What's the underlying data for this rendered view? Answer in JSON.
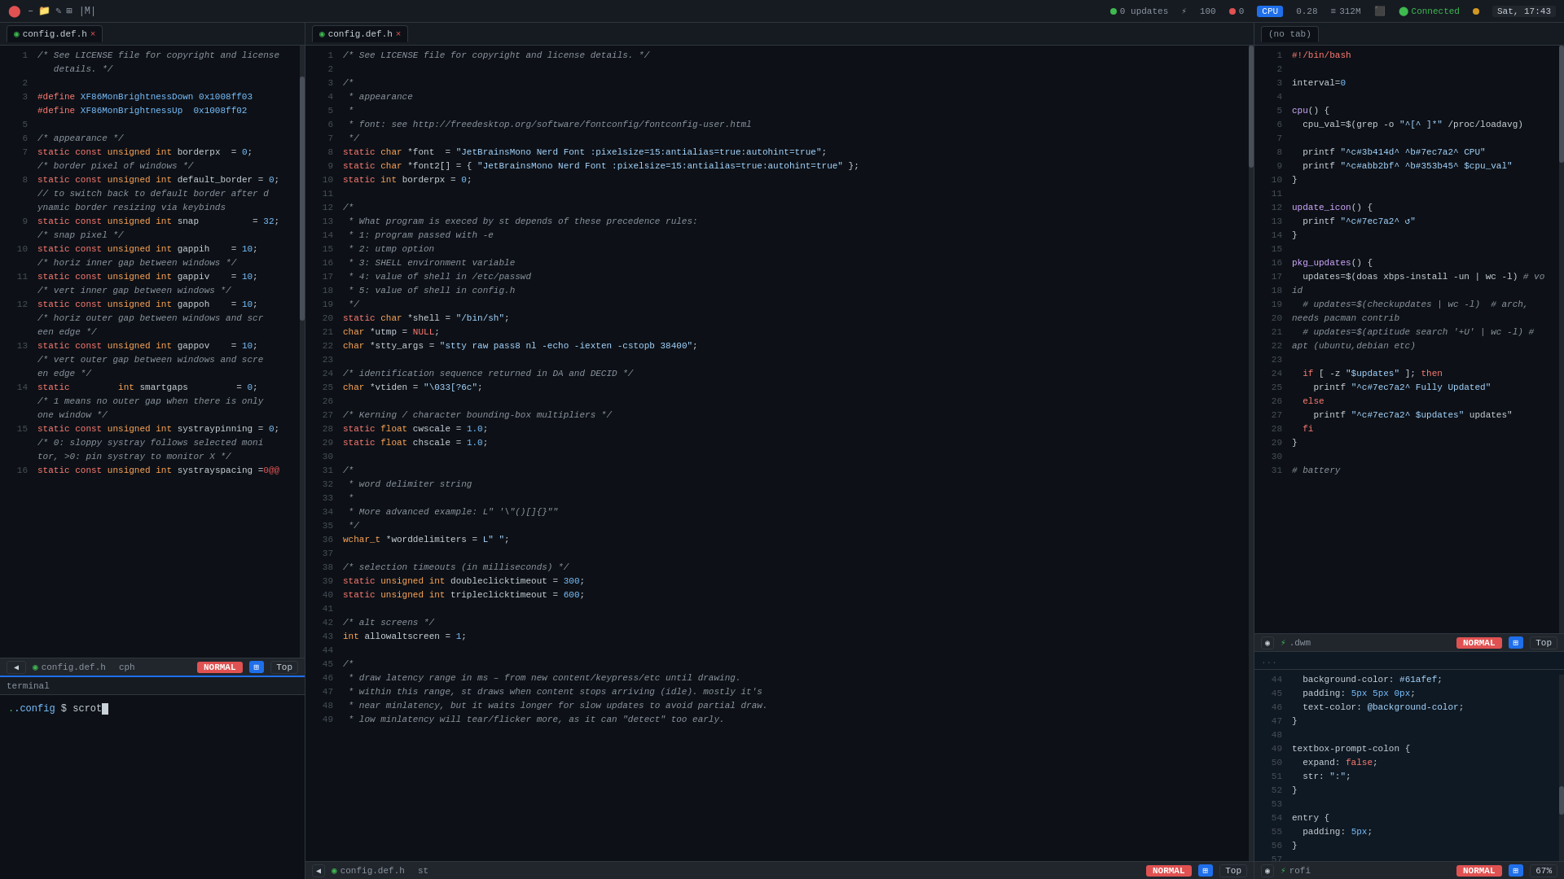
{
  "topbar": {
    "title": "|M|",
    "icons": [
      "–",
      "□",
      "×"
    ],
    "system": {
      "updates": "0 updates",
      "cpu_num": "100",
      "cpu_label": "CPU",
      "cpu_val": "0.28",
      "mem_label": "312M",
      "connected": "Connected",
      "time": "Sat, 17:43"
    }
  },
  "panels": {
    "left": {
      "tab": "config.def.h",
      "status_mode": "NORMAL",
      "status_pos": "Top",
      "status_file": "config.def.h",
      "status_branch": "cph",
      "lines": [
        {
          "num": "1",
          "content": "/* See LICENSE file for copyright and license",
          "type": "cmt"
        },
        {
          "num": "",
          "content": "   details. */",
          "type": "cmt"
        },
        {
          "num": "2",
          "content": "",
          "type": "normal"
        },
        {
          "num": "3",
          "content": "#define XF86MonBrightnessDown 0x1008ff03",
          "type": "def"
        },
        {
          "num": "",
          "content": "#define XF86MonBrightnessUp  0x1008ff02",
          "type": "def"
        },
        {
          "num": "5",
          "content": "",
          "type": "normal"
        },
        {
          "num": "6",
          "content": "/* appearance */",
          "type": "cmt"
        },
        {
          "num": "7",
          "content": "static const unsigned int borderpx  = 0;",
          "type": "code"
        },
        {
          "num": "",
          "content": "/* border pixel of windows */",
          "type": "cmt"
        },
        {
          "num": "8",
          "content": "static const unsigned int default_border = 0;",
          "type": "code"
        },
        {
          "num": "",
          "content": "// to switch back to default border after d",
          "type": "cmt"
        },
        {
          "num": "",
          "content": "ynamic border resizing via keybinds",
          "type": "cmt"
        },
        {
          "num": "9",
          "content": "static const unsigned int snap          = 32;",
          "type": "code"
        },
        {
          "num": "",
          "content": "/* snap pixel */",
          "type": "cmt"
        },
        {
          "num": "10",
          "content": "static const unsigned int gappih    = 10;",
          "type": "code"
        },
        {
          "num": "",
          "content": "/* horiz inner gap between windows */",
          "type": "cmt"
        },
        {
          "num": "11",
          "content": "static const unsigned int gappiv    = 10;",
          "type": "code"
        },
        {
          "num": "",
          "content": "/* vert inner gap between windows */",
          "type": "cmt"
        },
        {
          "num": "12",
          "content": "static const unsigned int gappoh    = 10;",
          "type": "code"
        },
        {
          "num": "",
          "content": "/* horiz outer gap between windows and scr",
          "type": "cmt"
        },
        {
          "num": "",
          "content": "een edge */",
          "type": "cmt"
        },
        {
          "num": "13",
          "content": "static const unsigned int gappov    = 10;",
          "type": "code"
        },
        {
          "num": "",
          "content": "/* vert outer gap between windows and scre",
          "type": "cmt"
        },
        {
          "num": "",
          "content": "en edge */",
          "type": "cmt"
        },
        {
          "num": "14",
          "content": "static         int smartgaps         = 0;",
          "type": "code"
        },
        {
          "num": "",
          "content": "/* 1 means no outer gap when there is only",
          "type": "cmt"
        },
        {
          "num": "",
          "content": "one window */",
          "type": "cmt"
        },
        {
          "num": "15",
          "content": "static const unsigned int systraypinning = 0;",
          "type": "code"
        },
        {
          "num": "",
          "content": "/* 0: sloppy systray follows selected moni",
          "type": "cmt"
        },
        {
          "num": "",
          "content": "tor, >0: pin systray to monitor X */",
          "type": "cmt"
        },
        {
          "num": "16",
          "content": "static const unsigned int systrayspacing =0@@",
          "type": "code"
        }
      ]
    },
    "mid": {
      "tab": "config.def.h",
      "status_mode": "NORMAL",
      "status_pos": "Top",
      "status_file": "config.def.h",
      "status_branch": "st",
      "lines": [
        {
          "num": "1",
          "content": "/* See LICENSE file for copyright and license details. */"
        },
        {
          "num": "2",
          "content": ""
        },
        {
          "num": "3",
          "content": "/*"
        },
        {
          "num": "4",
          "content": " * appearance"
        },
        {
          "num": "5",
          "content": " *"
        },
        {
          "num": "6",
          "content": " * font: see http://freedesktop.org/software/fontconfig/fontconfig-user.html"
        },
        {
          "num": "7",
          "content": " */"
        },
        {
          "num": "8",
          "content": "static char *font  = \"JetBrainsMono Nerd Font :pixelsize=15:antialias=true:autohint=true\";"
        },
        {
          "num": "9",
          "content": "static char *font2[] = { \"JetBrainsMono Nerd Font :pixelsize=15:antialias=true:autohint=true\" };"
        },
        {
          "num": "10",
          "content": "static int borderpx = 0;"
        },
        {
          "num": "11",
          "content": ""
        },
        {
          "num": "12",
          "content": "/*"
        },
        {
          "num": "13",
          "content": " * What program is execed by st depends of these precedence rules:"
        },
        {
          "num": "14",
          "content": " * 1: program passed with -e"
        },
        {
          "num": "15",
          "content": " * 2: utmp option"
        },
        {
          "num": "16",
          "content": " * 3: SHELL environment variable"
        },
        {
          "num": "17",
          "content": " * 4: value of shell in /etc/passwd"
        },
        {
          "num": "18",
          "content": " * 5: value of shell in config.h"
        },
        {
          "num": "19",
          "content": " */"
        },
        {
          "num": "20",
          "content": "static char *shell = \"/bin/sh\";"
        },
        {
          "num": "21",
          "content": "char *utmp = NULL;"
        },
        {
          "num": "22",
          "content": "char *stty_args = \"stty raw pass8 nl -echo -iexten -cstopb 38400\";"
        },
        {
          "num": "23",
          "content": ""
        },
        {
          "num": "24",
          "content": "/* identification sequence returned in DA and DECID */"
        },
        {
          "num": "25",
          "content": "char *vtiden = \"\\033[?6c\";"
        },
        {
          "num": "26",
          "content": ""
        },
        {
          "num": "27",
          "content": "/* Kerning / character bounding-box multipliers */"
        },
        {
          "num": "28",
          "content": "static float cwscale = 1.0;"
        },
        {
          "num": "29",
          "content": "static float chscale = 1.0;"
        },
        {
          "num": "30",
          "content": ""
        },
        {
          "num": "31",
          "content": "/*"
        },
        {
          "num": "32",
          "content": " * word delimiter string"
        },
        {
          "num": "33",
          "content": " *"
        },
        {
          "num": "34",
          "content": " * More advanced example: L\" '\\\"()[]{}\""
        },
        {
          "num": "35",
          "content": " */"
        },
        {
          "num": "36",
          "content": "wchar_t *worddelimiters = L\" \";"
        },
        {
          "num": "37",
          "content": ""
        },
        {
          "num": "38",
          "content": "/* selection timeouts (in milliseconds) */"
        },
        {
          "num": "39",
          "content": "static unsigned int doubleclicktimeout = 300;"
        },
        {
          "num": "40",
          "content": "static unsigned int tripleclicktimeout = 600;"
        },
        {
          "num": "41",
          "content": ""
        },
        {
          "num": "42",
          "content": "/* alt screens */"
        },
        {
          "num": "43",
          "content": "int allowaltscreen = 1;"
        },
        {
          "num": "44",
          "content": ""
        },
        {
          "num": "45",
          "content": "/*"
        },
        {
          "num": "46",
          "content": " * draw latency range in ms – from new content/keypress/etc until drawing."
        },
        {
          "num": "47",
          "content": " * within this range, st draws when content stops arriving (idle). mostly it's"
        },
        {
          "num": "48",
          "content": " * near minlatency, but it waits longer for slow updates to avoid partial draw."
        },
        {
          "num": "49",
          "content": " * low minlatency will tear/flicker more, as it can \"detect\" too early."
        }
      ]
    },
    "right_top": {
      "tab": "",
      "status_mode": "NORMAL",
      "status_pos": "Top",
      "status_file": ".dwm",
      "lines": [
        {
          "num": "1",
          "content": "#!/bin/bash"
        },
        {
          "num": "2",
          "content": ""
        },
        {
          "num": "3",
          "content": "interval=0"
        },
        {
          "num": "4",
          "content": ""
        },
        {
          "num": "5",
          "content": "cpu() {"
        },
        {
          "num": "6",
          "content": "  cpu_val=$(grep -o \"^[^ ]*\" /proc/loadavg)"
        },
        {
          "num": "7",
          "content": ""
        },
        {
          "num": "8",
          "content": "  printf \"^c#3b414d^ ^b#7ec7a2^ CPU\""
        },
        {
          "num": "9",
          "content": "  printf \"^c#abb2bf^ ^b#353b45^ $cpu_val\""
        },
        {
          "num": "10",
          "content": "}"
        },
        {
          "num": "11",
          "content": ""
        },
        {
          "num": "12",
          "content": "update_icon() {"
        },
        {
          "num": "13",
          "content": "  printf \"^c#7ec7a2^ ↺\""
        },
        {
          "num": "14",
          "content": "}"
        },
        {
          "num": "15",
          "content": ""
        },
        {
          "num": "16",
          "content": "pkg_updates() {"
        },
        {
          "num": "17",
          "content": "  updates=$(doas xbps-install -un | wc -l) # vo"
        },
        {
          "num": "18",
          "content": "id"
        },
        {
          "num": "19",
          "content": "  # updates=$(checkupdates | wc -l)  # arch,"
        },
        {
          "num": "20",
          "content": "needs pacman contrib"
        },
        {
          "num": "21",
          "content": "  # updates=$(aptitude search '+U' | wc -l) #"
        },
        {
          "num": "22",
          "content": "apt (ubuntu,debian etc)"
        },
        {
          "num": "23",
          "content": ""
        },
        {
          "num": "24",
          "content": "  if [ -z \"$updates\" ]; then"
        },
        {
          "num": "25",
          "content": "    printf \"^c#7ec7a2^ Fully Updated\""
        },
        {
          "num": "26",
          "content": "  else"
        },
        {
          "num": "27",
          "content": "    printf \"^c#7ec7a2^ $updates\" updates\""
        },
        {
          "num": "28",
          "content": "  fi"
        },
        {
          "num": "29",
          "content": "}"
        },
        {
          "num": "30",
          "content": ""
        },
        {
          "num": "31",
          "content": "# battery"
        }
      ]
    },
    "right_bottom": {
      "status_mode": "NORMAL",
      "status_pos": "67%",
      "status_file": "rofi",
      "lines": [
        {
          "num": "44",
          "content": "  background-color: #61afef;"
        },
        {
          "num": "45",
          "content": "  padding: 5px 5px 0px;"
        },
        {
          "num": "46",
          "content": "  text-color: @background-color;"
        },
        {
          "num": "47",
          "content": "}"
        },
        {
          "num": "48",
          "content": ""
        },
        {
          "num": "49",
          "content": "textbox-prompt-colon {"
        },
        {
          "num": "50",
          "content": "  expand: false;"
        },
        {
          "num": "51",
          "content": "  str: \":\";"
        },
        {
          "num": "52",
          "content": "}"
        },
        {
          "num": "53",
          "content": ""
        },
        {
          "num": "54",
          "content": "entry {"
        },
        {
          "num": "55",
          "content": "  padding: 5px;"
        },
        {
          "num": "56",
          "content": "}"
        },
        {
          "num": "57",
          "content": ""
        }
      ]
    }
  },
  "terminal": {
    "path": ".config",
    "cmd": "scrot",
    "cursor": true
  }
}
